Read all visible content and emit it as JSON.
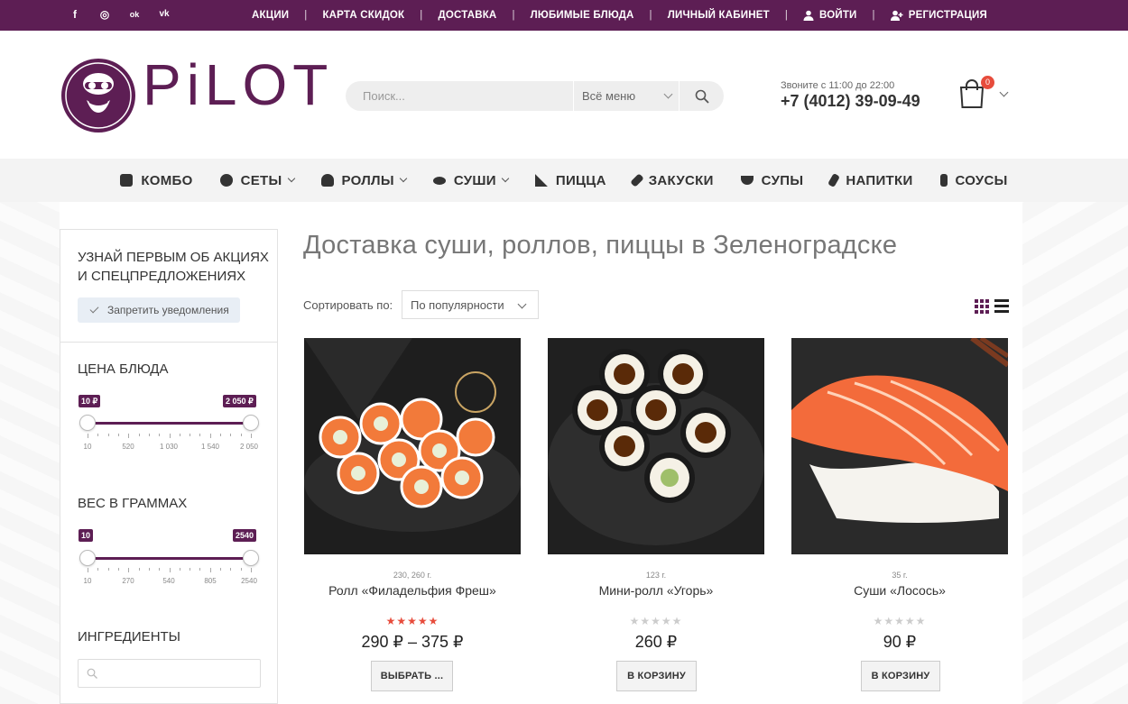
{
  "topbar": {
    "social": [
      {
        "icon": "facebook-icon",
        "glyph": "f"
      },
      {
        "icon": "instagram-icon",
        "glyph": "◎"
      },
      {
        "icon": "odnoklassniki-icon",
        "glyph": "ok"
      },
      {
        "icon": "vk-icon",
        "glyph": "vk"
      }
    ],
    "links": [
      "АКЦИИ",
      "КАРТА СКИДОК",
      "ДОСТАВКА",
      "ЛЮБИМЫЕ БЛЮДА",
      "ЛИЧНЫЙ КАБИНЕТ"
    ],
    "login": "ВОЙТИ",
    "register": "РЕГИСТРАЦИЯ",
    "separator": "|"
  },
  "header": {
    "logo_text": "PiLOT",
    "search_placeholder": "Поиск...",
    "search_category": "Всё меню",
    "phone_note": "Звоните с 11:00 до 22:00",
    "phone": "+7 (4012) 39-09-49",
    "cart_count": "0"
  },
  "catnav": [
    {
      "label": "КОМБО",
      "icon": "combo-icon",
      "dropdown": false
    },
    {
      "label": "СЕТЫ",
      "icon": "sets-icon",
      "dropdown": true
    },
    {
      "label": "РОЛЛЫ",
      "icon": "rolls-icon",
      "dropdown": true
    },
    {
      "label": "СУШИ",
      "icon": "sushi-icon",
      "dropdown": true
    },
    {
      "label": "ПИЦЦА",
      "icon": "pizza-icon",
      "dropdown": false
    },
    {
      "label": "ЗАКУСКИ",
      "icon": "snacks-icon",
      "dropdown": false
    },
    {
      "label": "СУПЫ",
      "icon": "soups-icon",
      "dropdown": false
    },
    {
      "label": "НАПИТКИ",
      "icon": "drinks-icon",
      "dropdown": false
    },
    {
      "label": "СОУСЫ",
      "icon": "sauces-icon",
      "dropdown": false
    }
  ],
  "sidebar": {
    "promo_title_1": "УЗНАЙ ПЕРВЫМ ОБ АКЦИЯХ",
    "promo_title_2": "И СПЕЦПРЕДЛОЖЕНИЯХ",
    "notify_button": "Запретить уведомления",
    "price_title": "ЦЕНА БЛЮДА",
    "price_min": "10 ₽",
    "price_max": "2 050 ₽",
    "price_ticks": [
      "10",
      "520",
      "1 030",
      "1 540",
      "2 050"
    ],
    "weight_title": "ВЕС В ГРАММАХ",
    "weight_min": "10",
    "weight_max": "2540",
    "weight_ticks": [
      "10",
      "270",
      "540",
      "805",
      "2540"
    ],
    "ingredients_title": "ИНГРЕДИЕНТЫ"
  },
  "main": {
    "title": "Доставка суши, роллов, пиццы в Зеленоградске",
    "sort_label": "Сортировать по:",
    "sort_value": "По популярности"
  },
  "products": [
    {
      "weight": "230, 260 г.",
      "name": "Ролл «Филадельфия Фреш»",
      "rating": 5,
      "price": "290 ₽ – 375 ₽",
      "button": "ВЫБРАТЬ ..."
    },
    {
      "weight": "123 г.",
      "name": "Мини-ролл «Угорь»",
      "rating": 0,
      "price": "260 ₽",
      "button": "В КОРЗИНУ"
    },
    {
      "weight": "35 г.",
      "name": "Суши «Лосось»",
      "rating": 0,
      "price": "90 ₽",
      "button": "В КОРЗИНУ"
    }
  ],
  "colors": {
    "brand": "#5d1e54",
    "star_active": "#e74c3c",
    "star_inactive": "#cccccc"
  }
}
